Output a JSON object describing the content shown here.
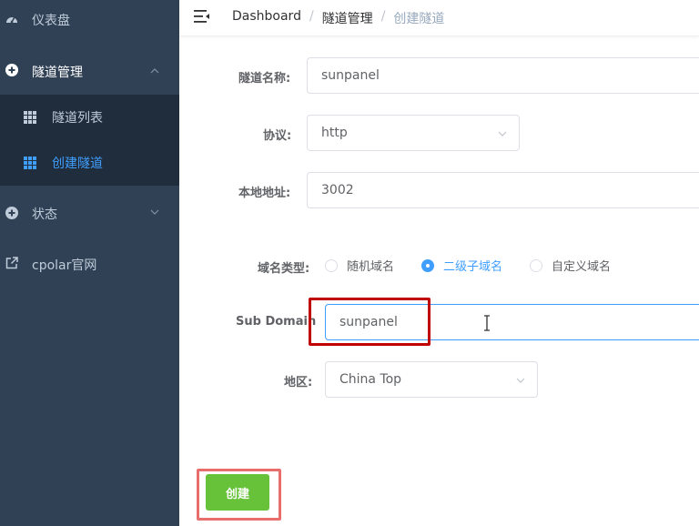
{
  "colors": {
    "sidebar_bg": "#304156",
    "submenu_bg": "#1f2d3d",
    "accent": "#409eff",
    "success": "#67c23a",
    "highlight_dark": "#c00000",
    "highlight_light": "#e86d6d"
  },
  "sidebar": {
    "items": [
      {
        "label": "仪表盘",
        "icon": "dashboard-gauge-icon"
      },
      {
        "label": "隧道管理",
        "icon": "plus-circle-icon",
        "expanded": true,
        "children": [
          {
            "label": "隧道列表",
            "icon": "grid-table-icon"
          },
          {
            "label": "创建隧道",
            "icon": "grid-table-icon",
            "active": true
          }
        ]
      },
      {
        "label": "状态",
        "icon": "plus-circle-icon",
        "expanded": false
      },
      {
        "label": "cpolar官网",
        "icon": "external-link-icon"
      }
    ]
  },
  "header": {
    "breadcrumb": [
      "Dashboard",
      "隧道管理",
      "创建隧道"
    ],
    "separator": "/"
  },
  "form": {
    "tunnel_name": {
      "label": "隧道名称:",
      "value": "sunpanel"
    },
    "protocol": {
      "label": "协议:",
      "value": "http"
    },
    "local_address": {
      "label": "本地地址:",
      "value": "3002"
    },
    "domain_type": {
      "label": "域名类型:",
      "options": [
        "随机域名",
        "二级子域名",
        "自定义域名"
      ],
      "selected": "二级子域名"
    },
    "sub_domain": {
      "label": "Sub Domain",
      "value": "sunpanel"
    },
    "region": {
      "label": "地区:",
      "value": "China Top"
    },
    "submit_label": "创建"
  }
}
